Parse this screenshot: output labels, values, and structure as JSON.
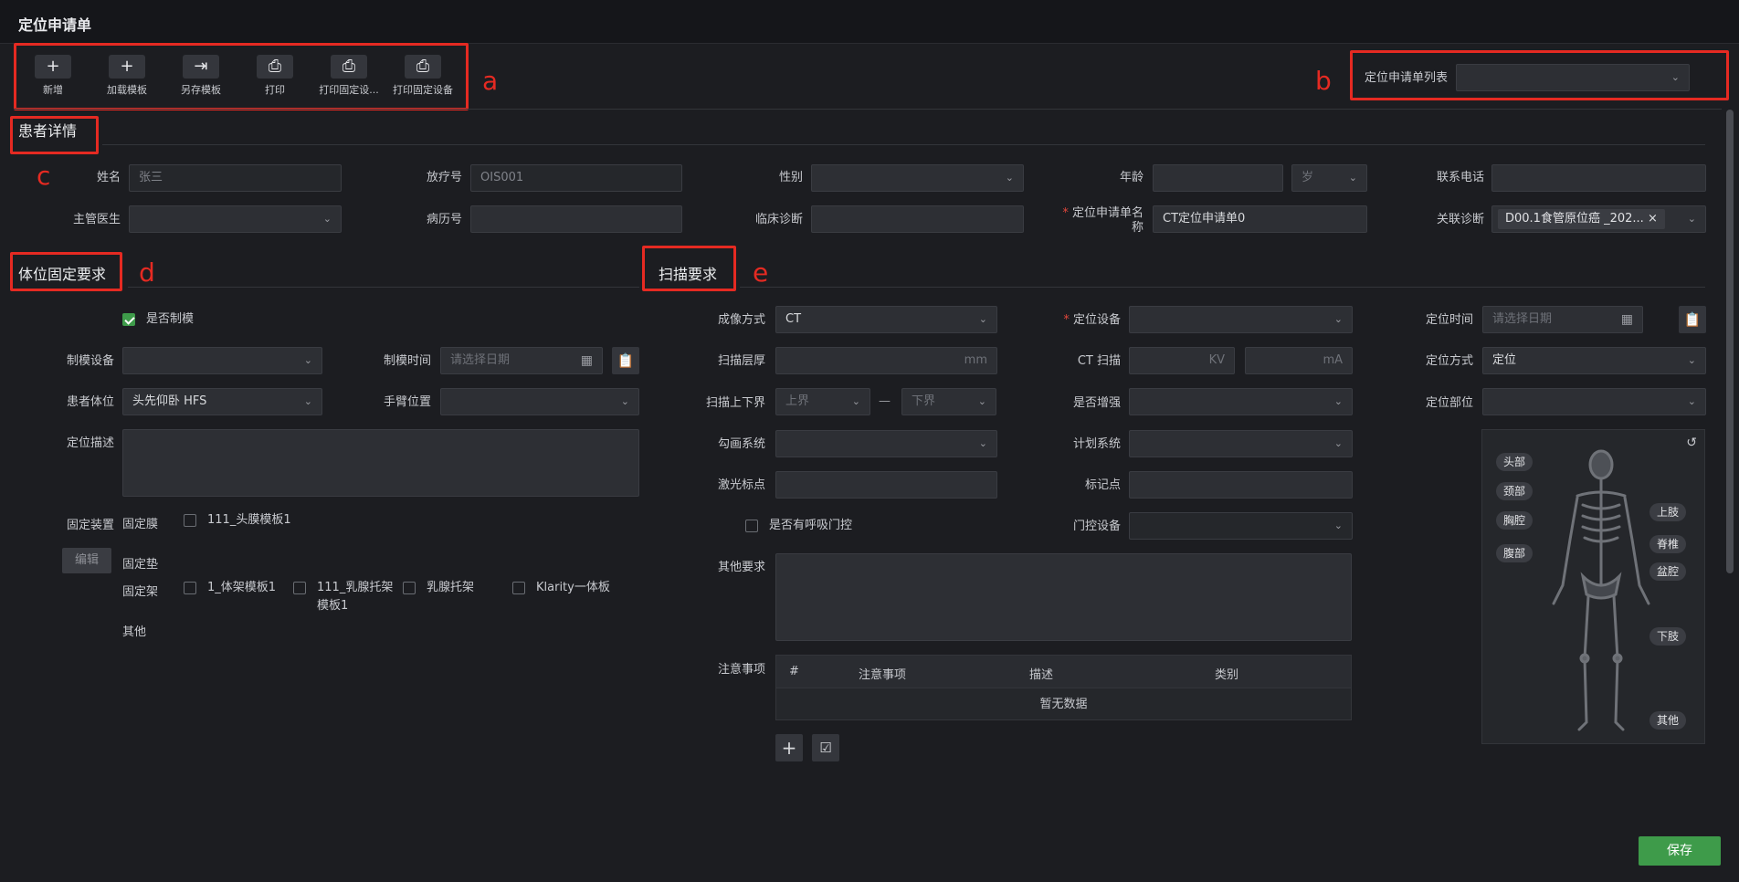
{
  "title": "定位申请单",
  "toolbar": {
    "items": [
      "新增",
      "加载模板",
      "另存模板",
      "打印",
      "打印固定设...",
      "打印固定设备"
    ]
  },
  "list_select": {
    "label": "定位申请单列表",
    "value": ""
  },
  "annotations": {
    "a": "a",
    "b": "b",
    "c": "c",
    "d": "d",
    "e": "e"
  },
  "patient": {
    "section": "患者详情",
    "name_label": "姓名",
    "name_value": "张三",
    "radio_no_label": "放疗号",
    "radio_no_value": "OIS001",
    "gender_label": "性别",
    "gender_value": "",
    "age_label": "年龄",
    "age_value": "",
    "age_unit": "岁",
    "phone_label": "联系电话",
    "phone_value": "",
    "doctor_label": "主管医生",
    "doctor_value": "",
    "record_label": "病历号",
    "record_value": "",
    "diagnosis_label": "临床诊断",
    "diagnosis_value": "",
    "form_name_label": "定位申请单名称",
    "form_name_value": "CT定位申请单0",
    "rel_diag_label": "关联诊断",
    "rel_diag_value": "D00.1食管原位癌 _202..."
  },
  "fixation": {
    "section": "体位固定要求",
    "mold_check_label": "是否制模",
    "mold_device_label": "制模设备",
    "mold_device_value": "",
    "mold_time_label": "制模时间",
    "mold_time_placeholder": "请选择日期",
    "position_label": "患者体位",
    "position_value": "头先仰卧 HFS",
    "arm_label": "手臂位置",
    "arm_value": "",
    "desc_label": "定位描述",
    "device_label": "固定装置",
    "edit_label": "编辑",
    "film_label": "固定膜",
    "film_item": "111_头膜模板1",
    "pad_label": "固定垫",
    "frame_label": "固定架",
    "frame_items": [
      "1_体架模板1",
      "111_乳腺托架模板1",
      "乳腺托架",
      "Klarity一体板"
    ],
    "other_label": "其他"
  },
  "scan": {
    "section": "扫描要求",
    "imaging_label": "成像方式",
    "imaging_value": "CT",
    "thickness_label": "扫描层厚",
    "thickness_unit": "mm",
    "range_label": "扫描上下界",
    "upper_placeholder": "上界",
    "lower_placeholder": "下界",
    "range_sep": "—",
    "contour_label": "勾画系统",
    "contour_value": "",
    "laser_label": "激光标点",
    "laser_value": "",
    "gating_check_label": "是否有呼吸门控",
    "other_req_label": "其他要求",
    "notes_label": "注意事项",
    "notes_columns": [
      "#",
      "注意事项",
      "描述",
      "类别"
    ],
    "notes_empty": "暂无数据",
    "device_label": "定位设备",
    "device_value": "",
    "ct_label": "CT 扫描",
    "kv_unit": "KV",
    "ma_unit": "mA",
    "enhance_label": "是否增强",
    "enhance_value": "",
    "plan_label": "计划系统",
    "plan_value": "",
    "marker_label": "标记点",
    "marker_value": "",
    "gate_device_label": "门控设备",
    "gate_device_value": "",
    "time_label": "定位时间",
    "time_placeholder": "请选择日期",
    "method_label": "定位方式",
    "method_value": "定位",
    "site_label": "定位部位",
    "site_value": ""
  },
  "body_parts": [
    "头部",
    "颈部",
    "胸腔",
    "腹部",
    "上肢",
    "脊椎",
    "盆腔",
    "下肢",
    "其他"
  ],
  "save_label": "保存"
}
